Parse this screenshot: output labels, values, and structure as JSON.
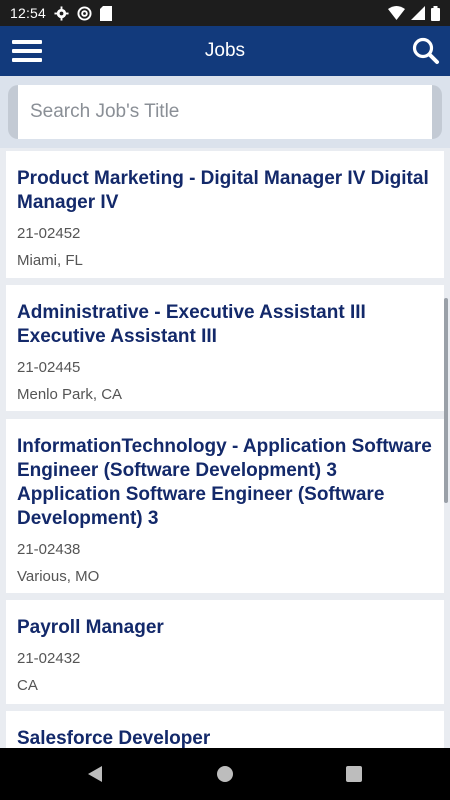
{
  "status_bar": {
    "time": "12:54",
    "left_icons": [
      "gear-icon",
      "at-sign-icon",
      "sd-card-icon"
    ],
    "right_icons": [
      "wifi-icon",
      "signal-icon",
      "battery-icon"
    ]
  },
  "app_bar": {
    "title": "Jobs",
    "menu_icon": "hamburger-menu-icon",
    "search_icon": "search-icon",
    "background": "#123a7c"
  },
  "search": {
    "placeholder": "Search Job's Title",
    "value": ""
  },
  "jobs": [
    {
      "title": "Product Marketing - Digital Manager IV Digital Manager IV",
      "req_id": "21-02452",
      "location": "Miami, FL"
    },
    {
      "title": "Administrative - Executive Assistant III Executive Assistant III",
      "req_id": "21-02445",
      "location": "Menlo Park, CA"
    },
    {
      "title": "InformationTechnology - Application Software Engineer (Software Development) 3  Application Software Engineer (Software Development) 3",
      "req_id": "21-02438",
      "location": "Various, MO"
    },
    {
      "title": "Payroll Manager",
      "req_id": "21-02432",
      "location": "CA"
    },
    {
      "title": "Salesforce Developer",
      "req_id": "",
      "location": ""
    }
  ],
  "colors": {
    "title_text": "#13296a",
    "meta_text": "#555555",
    "list_background": "#e9ecf1"
  }
}
